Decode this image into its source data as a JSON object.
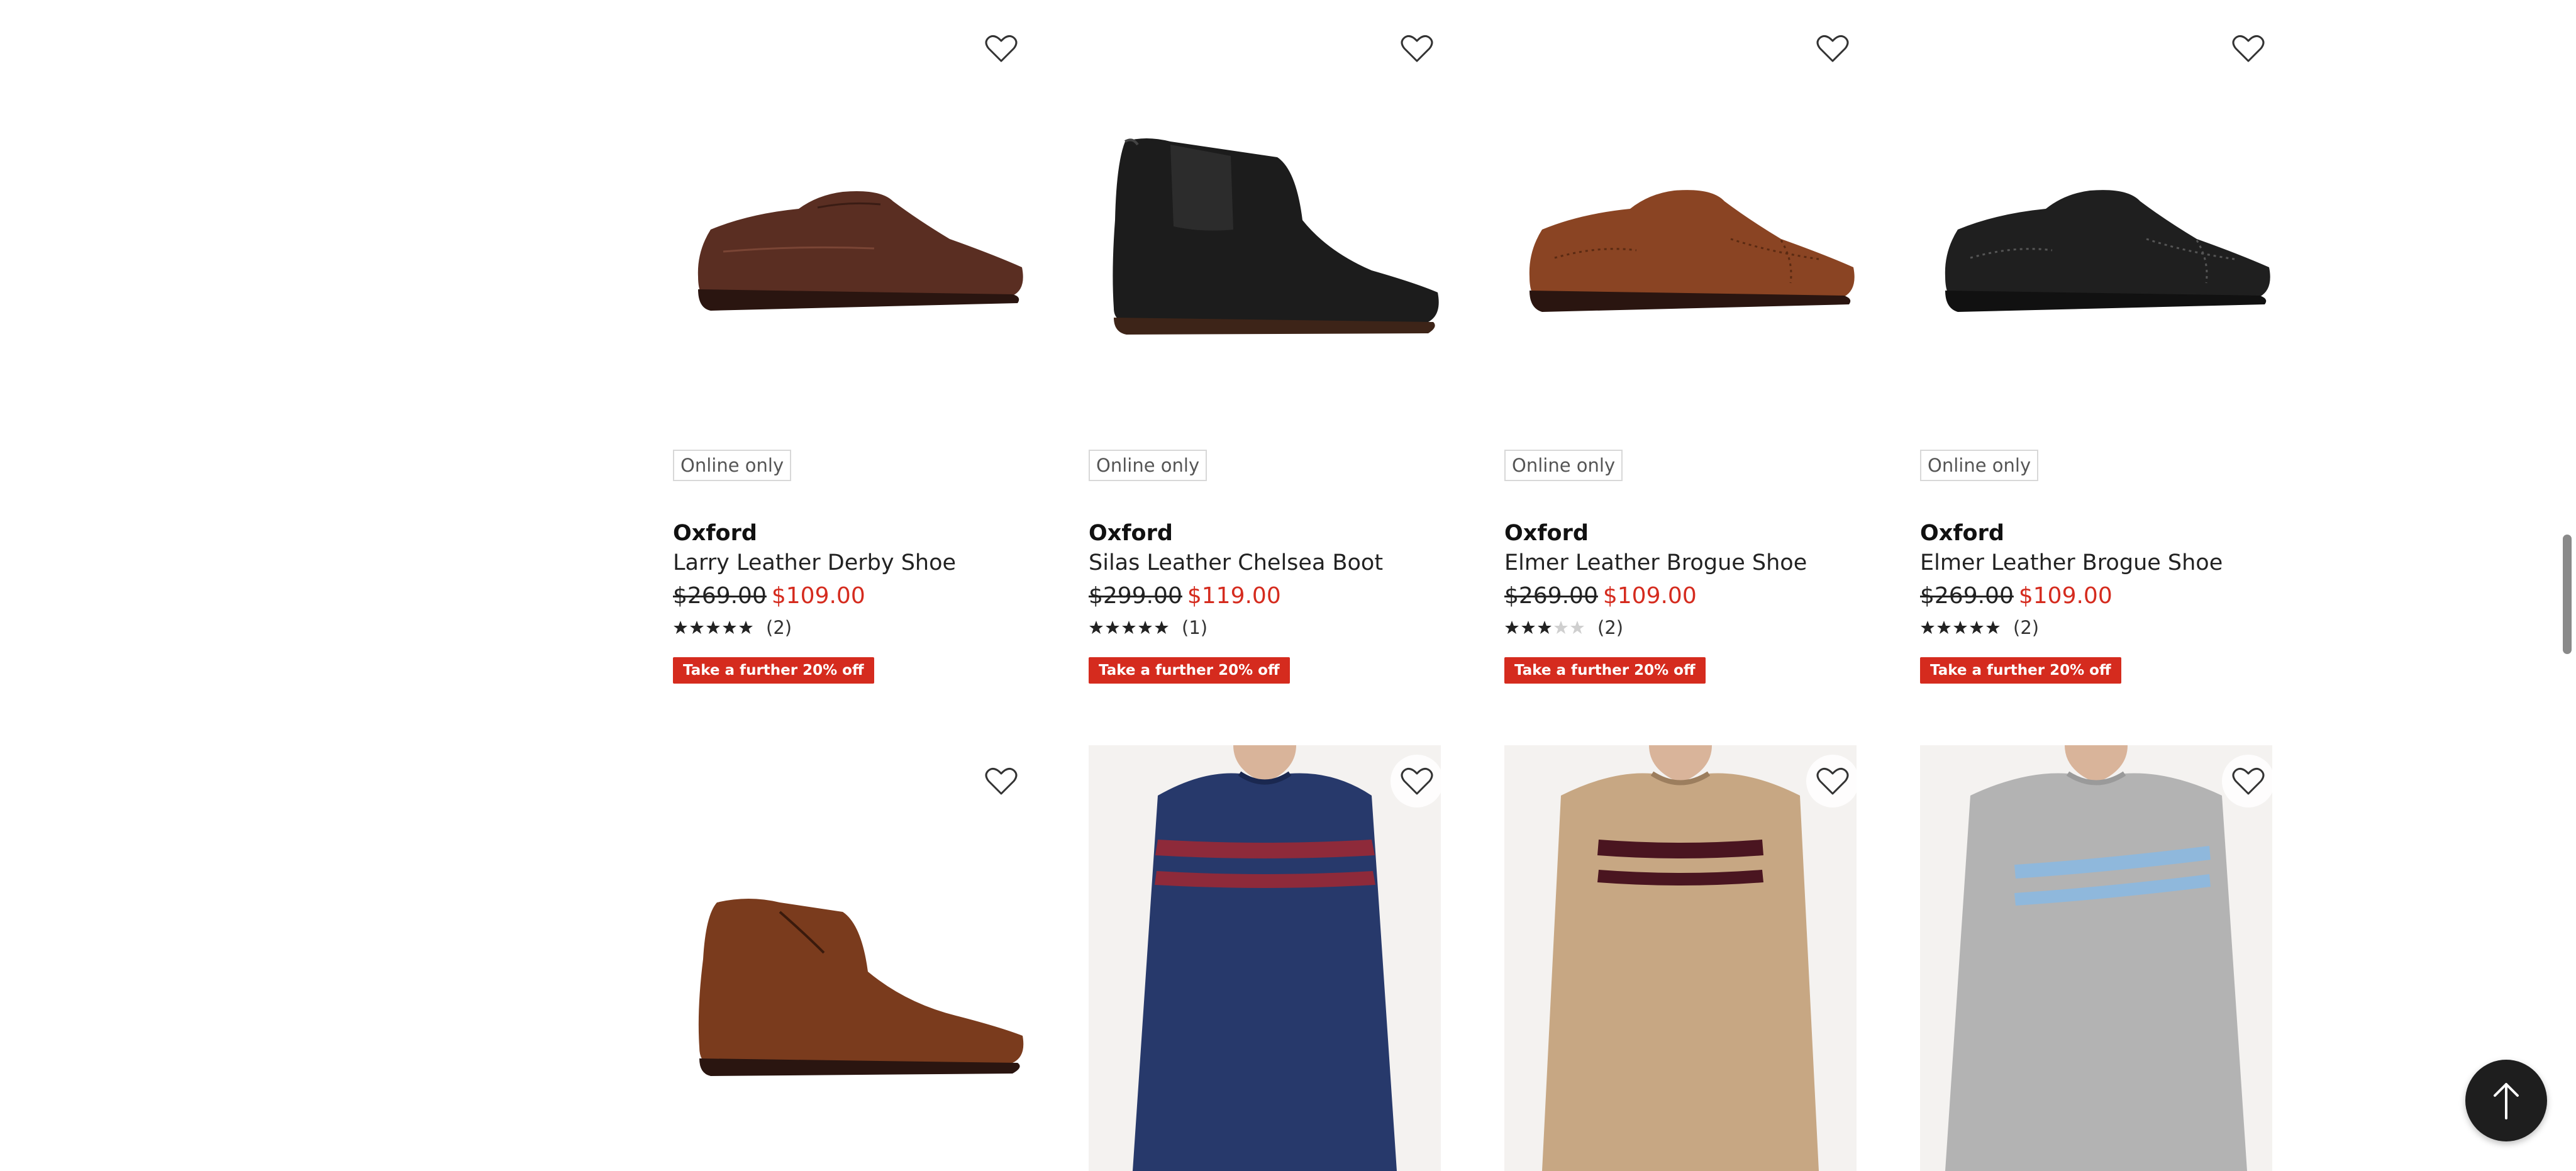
{
  "products_row1": [
    {
      "badge": "Online only",
      "brand": "Oxford",
      "name": "Larry Leather Derby Shoe",
      "was_price": "$269.00",
      "now_price": "$109.00",
      "rating": 5,
      "review_count": "(2)",
      "promo": "Take a further 20% off",
      "image": "brown-derby-shoe",
      "shoe_color": "#5a2e22"
    },
    {
      "badge": "Online only",
      "brand": "Oxford",
      "name": "Silas Leather Chelsea Boot",
      "was_price": "$299.00",
      "now_price": "$119.00",
      "rating": 5,
      "review_count": "(1)",
      "promo": "Take a further 20% off",
      "image": "black-chelsea-boot",
      "shoe_color": "#1c1c1c"
    },
    {
      "badge": "Online only",
      "brand": "Oxford",
      "name": "Elmer Leather Brogue Shoe",
      "was_price": "$269.00",
      "now_price": "$109.00",
      "rating": 3,
      "review_count": "(2)",
      "promo": "Take a further 20% off",
      "image": "tan-brogue-shoe",
      "shoe_color": "#8a4423"
    },
    {
      "badge": "Online only",
      "brand": "Oxford",
      "name": "Elmer Leather Brogue Shoe",
      "was_price": "$269.00",
      "now_price": "$109.00",
      "rating": 5,
      "review_count": "(2)",
      "promo": "Take a further 20% off",
      "image": "black-brogue-shoe",
      "shoe_color": "#1f1f1f"
    }
  ],
  "products_row2": [
    {
      "image": "tan-chukka-boot",
      "color": "#7a3b1d"
    },
    {
      "image": "navy-striped-sweater",
      "color": "#27396b",
      "stripe": "#8e2a3a"
    },
    {
      "image": "camel-striped-sweater",
      "color": "#c7a783",
      "stripe": "#4a1520"
    },
    {
      "image": "grey-striped-sweater",
      "color": "#b3b3b3",
      "stripe": "#8fb8dc"
    }
  ],
  "colors": {
    "sale_red": "#d52b1e",
    "star_filled": "#222222",
    "star_empty": "#cfcfcf",
    "back_to_top_bg": "#1e1e1e"
  },
  "icons": {
    "wishlist": "heart-outline-icon",
    "back_to_top": "arrow-up-icon"
  }
}
